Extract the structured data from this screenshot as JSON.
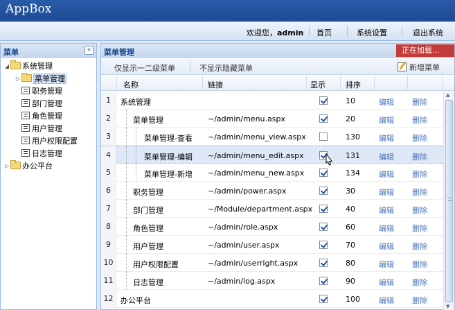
{
  "app": {
    "title": "AppBox"
  },
  "topbar": {
    "welcome_prefix": "欢迎您，",
    "user": "admin",
    "links": [
      "首页",
      "系统设置",
      "退出系统"
    ]
  },
  "left_panel": {
    "title": "菜单",
    "collapse_glyph": "«",
    "tree": [
      {
        "label": "系统管理",
        "type": "folder",
        "expanded": true,
        "level": 0
      },
      {
        "label": "菜单管理",
        "type": "folder",
        "expanded": false,
        "level": 1,
        "selected": true
      },
      {
        "label": "职务管理",
        "type": "leaf",
        "level": 1
      },
      {
        "label": "部门管理",
        "type": "leaf",
        "level": 1
      },
      {
        "label": "角色管理",
        "type": "leaf",
        "level": 1
      },
      {
        "label": "用户管理",
        "type": "leaf",
        "level": 1
      },
      {
        "label": "用户权限配置",
        "type": "leaf",
        "level": 1
      },
      {
        "label": "日志管理",
        "type": "leaf",
        "level": 1
      },
      {
        "label": "办公平台",
        "type": "folder",
        "expanded": false,
        "level": 0
      }
    ]
  },
  "main_panel": {
    "title": "菜单管理",
    "loading": "正在加载...",
    "toolbar": {
      "show_level2": "仅显示一二级菜单",
      "hide_hidden": "不显示隐藏菜单",
      "add": "新增菜单"
    },
    "columns": [
      "名称",
      "链接",
      "显示",
      "排序"
    ],
    "edit_label": "编辑",
    "delete_label": "删除",
    "rows": [
      {
        "num": "1",
        "name": "系统管理",
        "link": "",
        "visible": true,
        "order": "10",
        "depth": 0
      },
      {
        "num": "2",
        "name": "菜单管理",
        "link": "~/admin/menu.aspx",
        "visible": true,
        "order": "20",
        "depth": 1
      },
      {
        "num": "3",
        "name": "菜单管理-查看",
        "link": "~/admin/menu_view.aspx",
        "visible": false,
        "order": "130",
        "depth": 2
      },
      {
        "num": "4",
        "name": "菜单管理-编辑",
        "link": "~/admin/menu_edit.aspx",
        "visible": true,
        "order": "131",
        "depth": 2,
        "highlight": true
      },
      {
        "num": "5",
        "name": "菜单管理-新增",
        "link": "~/admin/menu_new.aspx",
        "visible": true,
        "order": "134",
        "depth": 2
      },
      {
        "num": "6",
        "name": "职务管理",
        "link": "~/admin/power.aspx",
        "visible": true,
        "order": "30",
        "depth": 1
      },
      {
        "num": "7",
        "name": "部门管理",
        "link": "~/Module/department.aspx",
        "visible": true,
        "order": "40",
        "depth": 1
      },
      {
        "num": "8",
        "name": "角色管理",
        "link": "~/admin/role.aspx",
        "visible": true,
        "order": "60",
        "depth": 1
      },
      {
        "num": "9",
        "name": "用户管理",
        "link": "~/admin/user.aspx",
        "visible": true,
        "order": "70",
        "depth": 1
      },
      {
        "num": "10",
        "name": "用户权限配置",
        "link": "~/admin/userright.aspx",
        "visible": true,
        "order": "80",
        "depth": 1
      },
      {
        "num": "11",
        "name": "日志管理",
        "link": "~/admin/log.aspx",
        "visible": true,
        "order": "90",
        "depth": 1
      },
      {
        "num": "12",
        "name": "办公平台",
        "link": "",
        "visible": true,
        "order": "100",
        "depth": 0
      }
    ]
  }
}
